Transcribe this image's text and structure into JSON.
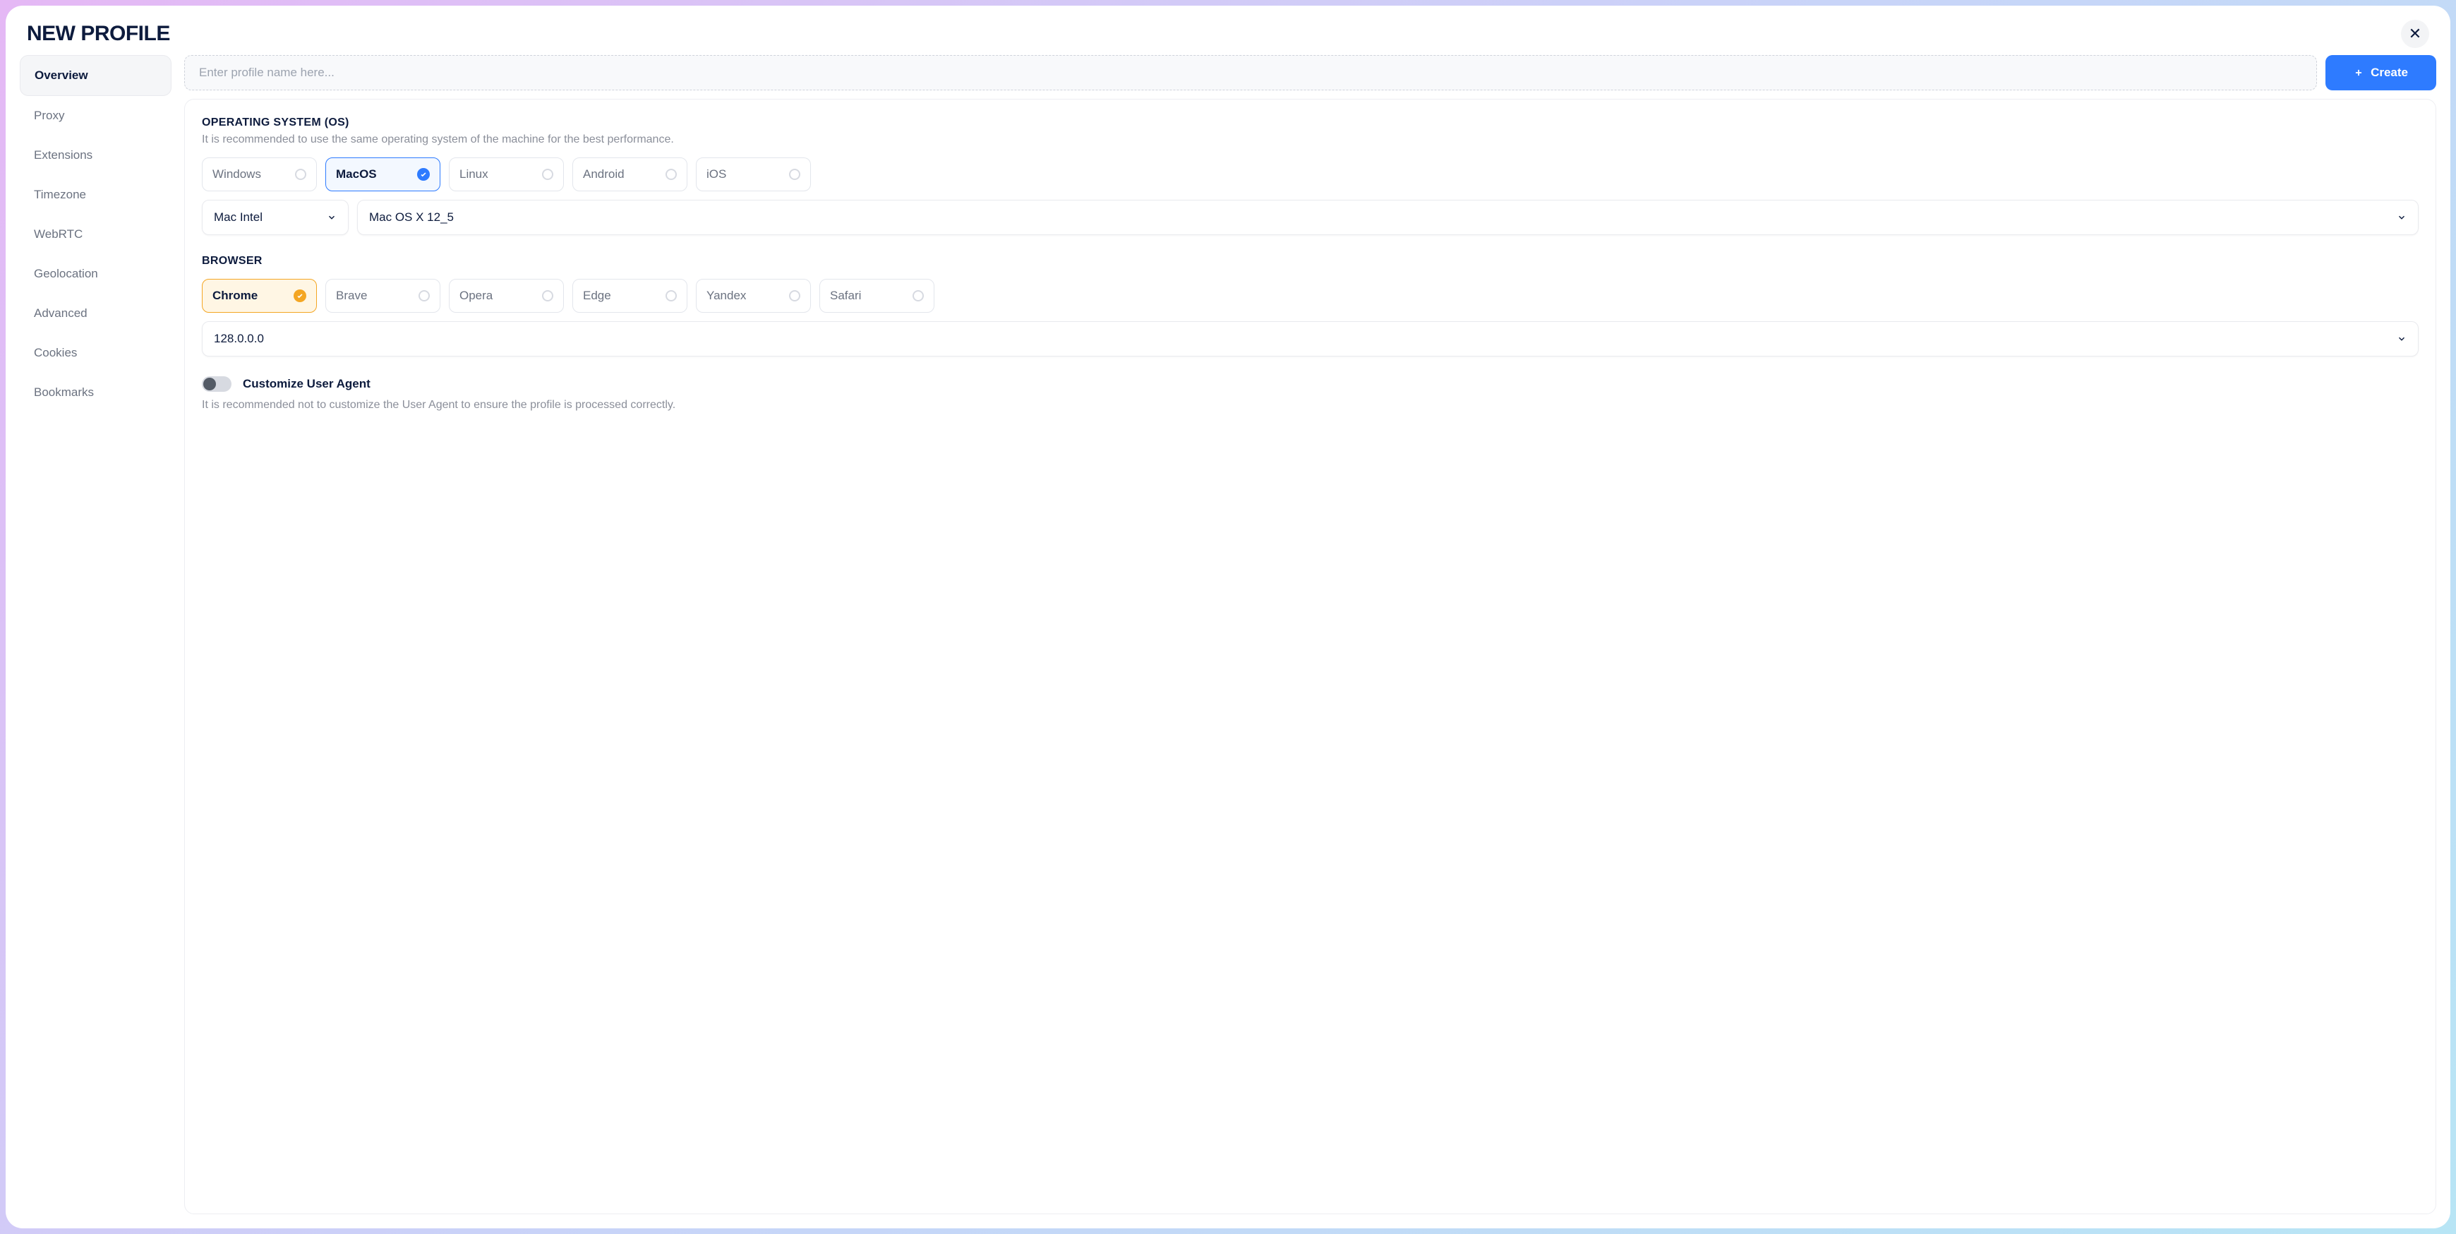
{
  "title": "NEW PROFILE",
  "createLabel": "Create",
  "namePlaceholder": "Enter profile name here...",
  "sidebar": {
    "items": [
      {
        "label": "Overview",
        "active": true
      },
      {
        "label": "Proxy"
      },
      {
        "label": "Extensions"
      },
      {
        "label": "Timezone"
      },
      {
        "label": "WebRTC"
      },
      {
        "label": "Geolocation"
      },
      {
        "label": "Advanced"
      },
      {
        "label": "Cookies"
      },
      {
        "label": "Bookmarks"
      }
    ]
  },
  "os": {
    "title": "OPERATING SYSTEM (OS)",
    "hint": "It is recommended to use the same operating system of the machine for the best performance.",
    "options": [
      "Windows",
      "MacOS",
      "Linux",
      "Android",
      "iOS"
    ],
    "selected": "MacOS",
    "archSelected": "Mac Intel",
    "versionSelected": "Mac OS X 12_5"
  },
  "browser": {
    "title": "BROWSER",
    "options": [
      "Chrome",
      "Brave",
      "Opera",
      "Edge",
      "Yandex",
      "Safari"
    ],
    "selected": "Chrome",
    "versionSelected": "128.0.0.0"
  },
  "ua": {
    "toggleLabel": "Customize User Agent",
    "hint": "It is recommended not to customize the User Agent to ensure the profile is processed correctly."
  }
}
